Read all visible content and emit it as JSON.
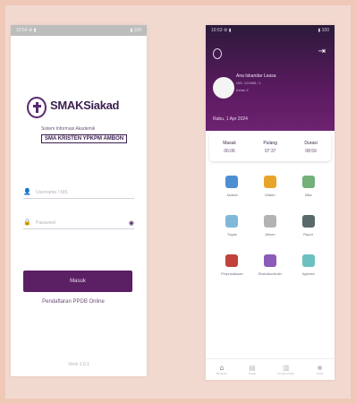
{
  "login": {
    "status_left": "10:54 ⚙ ▮",
    "status_right": "▮ 100",
    "app_name": "SMAKSiakad",
    "app_subtitle": "Sistem Informasi Akademik",
    "school_name": "SMA KRISTEN YPKPM AMBON",
    "username_placeholder": "Username / NIS",
    "password_placeholder": "Password",
    "login_button": "Masuk",
    "ppdb_link": "Pendaftaran PPDB Online",
    "version": "Versi 1.0.1"
  },
  "dashboard": {
    "status_left": "10:53 ⚙ ▮",
    "status_right": "▮ 100",
    "user_name": "Ana Iskandar Leasa",
    "user_id": "NIS: 123456 / 1",
    "user_class": "Kelas X",
    "date_label": "Rabu, 1 Apr 2024",
    "attendance": [
      {
        "label": "Masuk",
        "value": "06:06"
      },
      {
        "label": "Pulang",
        "value": "07:37"
      },
      {
        "label": "Durasi",
        "value": "08:59"
      }
    ],
    "menu": [
      {
        "label": "Jadwal",
        "color": "#4d8fd1"
      },
      {
        "label": "Materi",
        "color": "#e6a52a"
      },
      {
        "label": "Nilai",
        "color": "#73b07a"
      },
      {
        "label": "Tugas",
        "color": "#7fb9d9"
      },
      {
        "label": "Absen",
        "color": "#b3b3b3"
      },
      {
        "label": "Rapor",
        "color": "#5a6a6a"
      },
      {
        "label": "Perpustakaan",
        "color": "#c0423a"
      },
      {
        "label": "Ekstrakurikuler",
        "color": "#8b5bb8"
      },
      {
        "label": "Agenda",
        "color": "#6cc0c0"
      }
    ],
    "nav": [
      {
        "label": "Beranda",
        "icon": "home-icon"
      },
      {
        "label": "Tugas",
        "icon": "doc-icon"
      },
      {
        "label": "Pengumuman",
        "icon": "trash-icon"
      },
      {
        "label": "Profil",
        "icon": "user-icon"
      }
    ]
  }
}
